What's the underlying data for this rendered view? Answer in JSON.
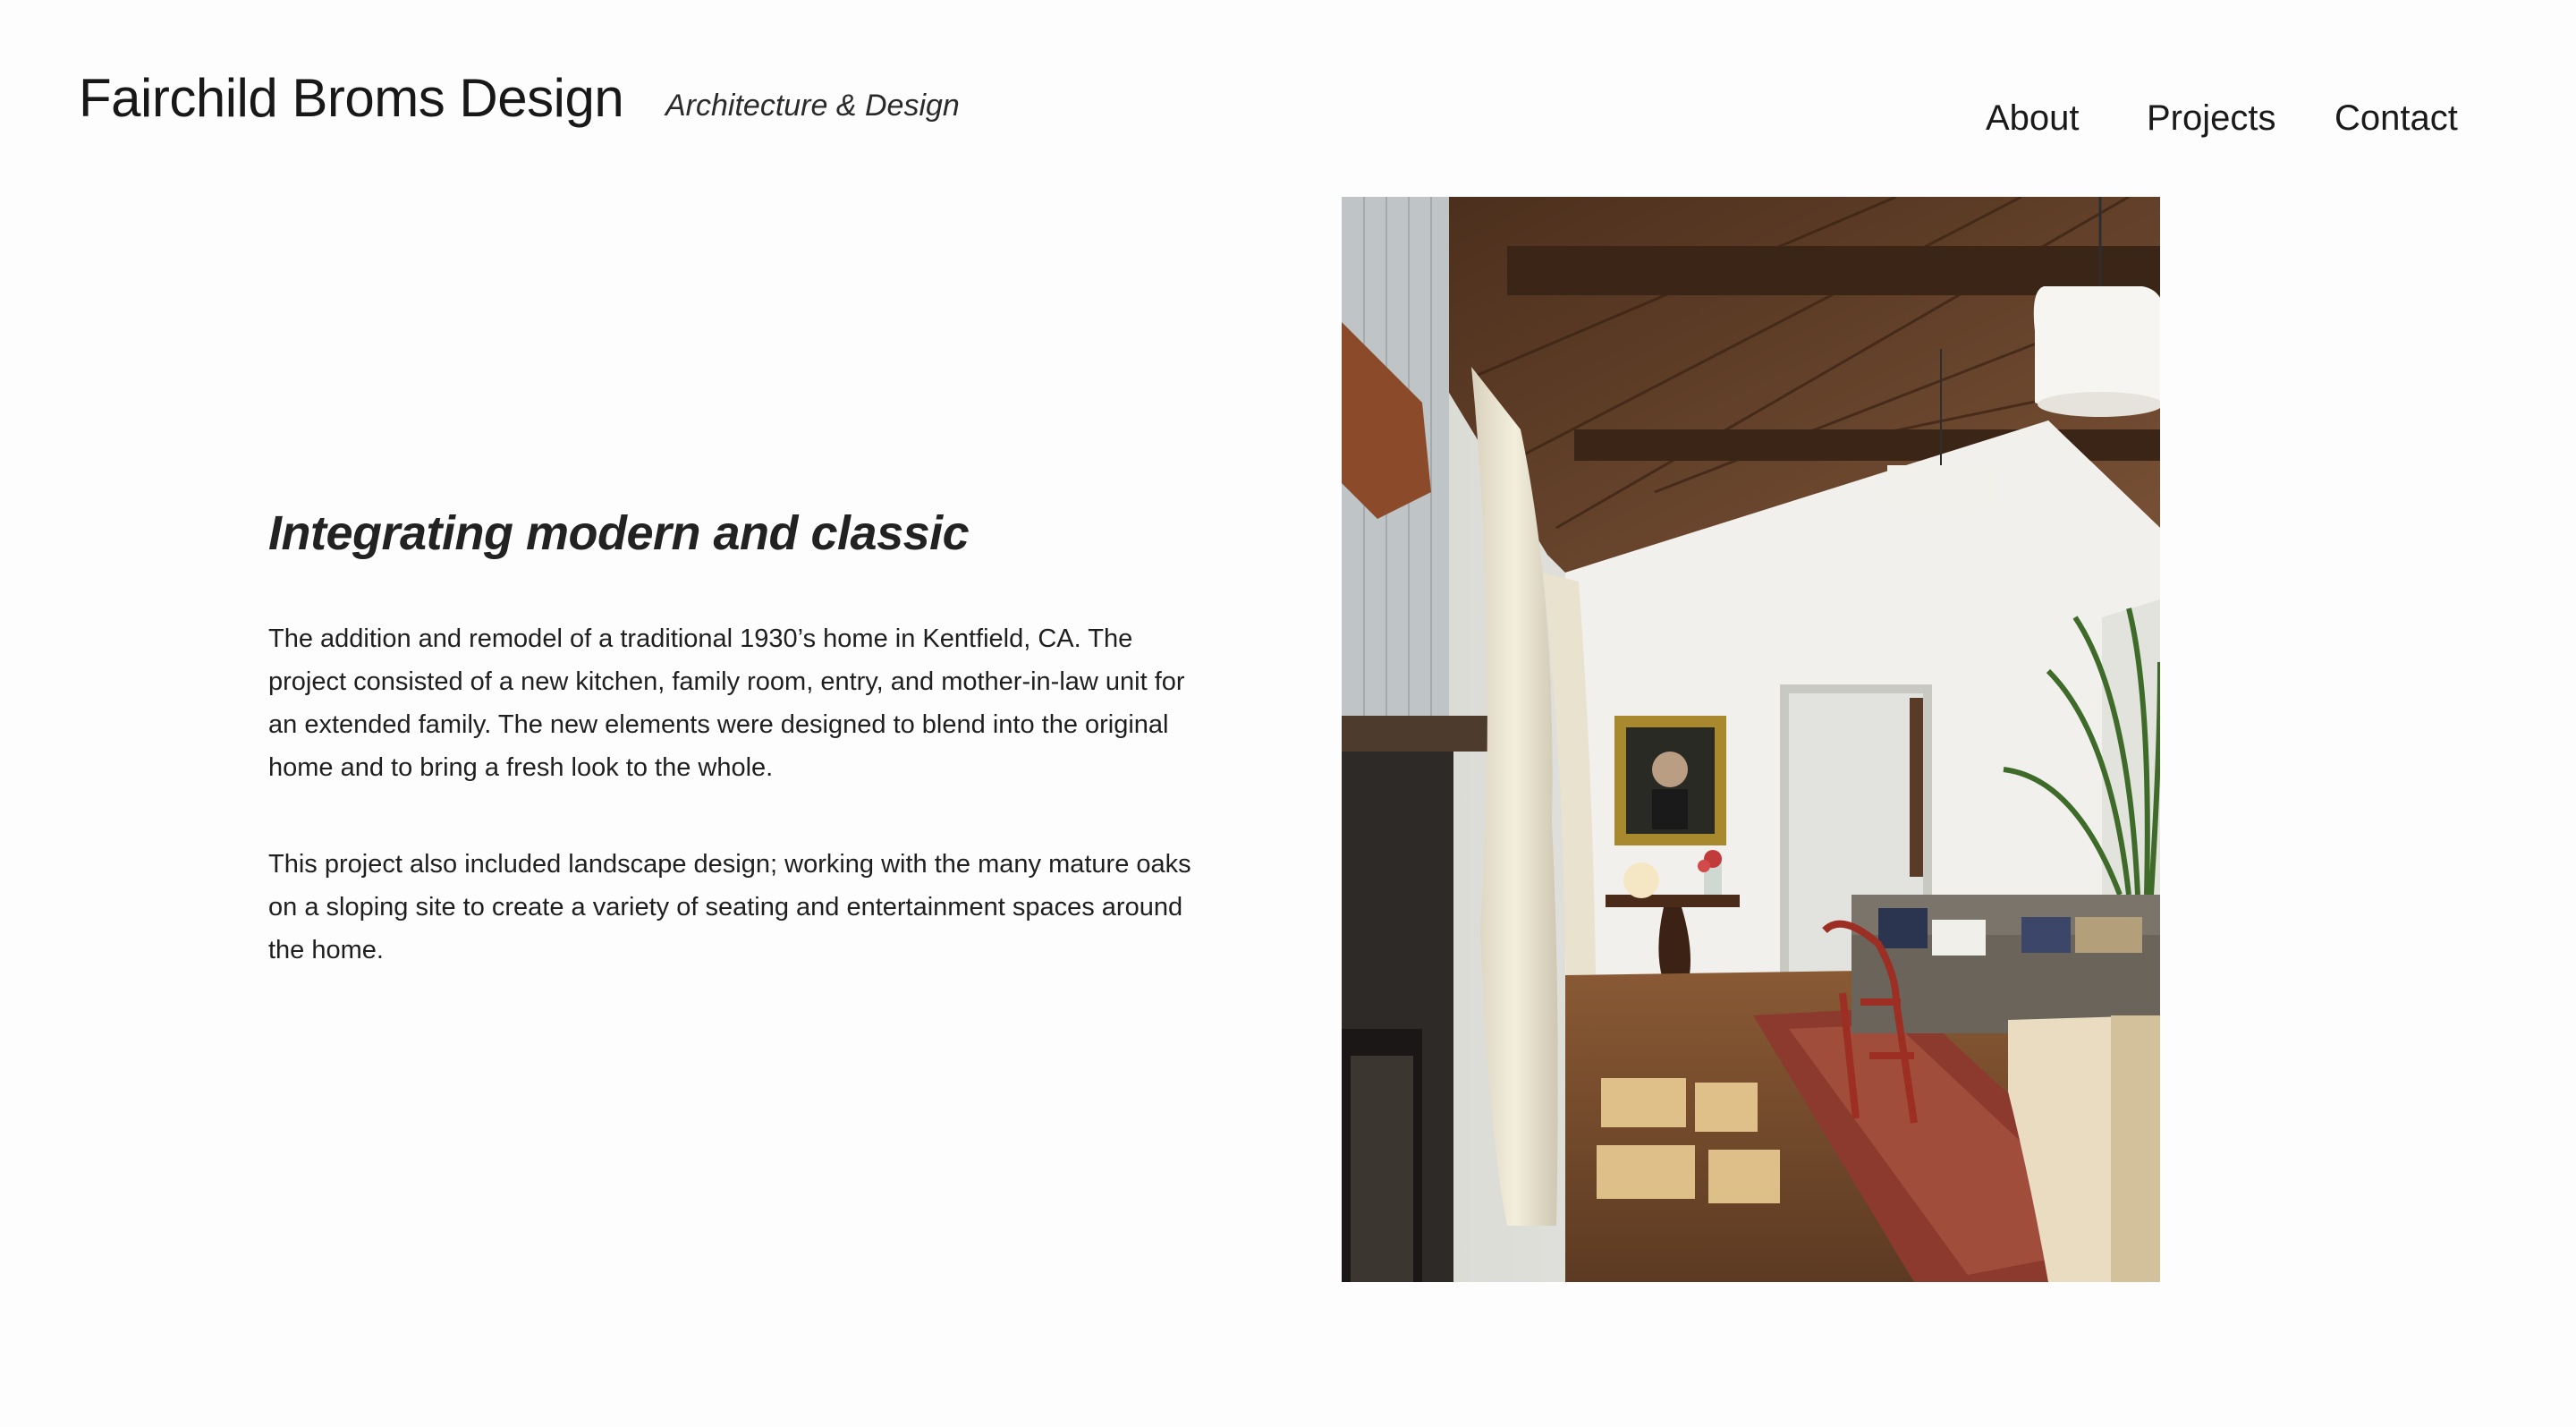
{
  "header": {
    "title": "Fairchild Broms Design",
    "tagline": "Architecture & Design"
  },
  "nav": {
    "items": [
      {
        "label": "About"
      },
      {
        "label": "Projects"
      },
      {
        "label": "Contact"
      }
    ]
  },
  "project": {
    "heading": "Integrating modern and classic",
    "paragraphs": [
      "The addition and remodel of a traditional 1930’s home in Kentfield, CA. The project consisted of a new kitchen, family room, entry, and mother-in-law unit for an extended family. The new elements were designed to blend into the original home and to bring a fresh look to the whole.",
      "This project also included landscape design; working with the many mature oaks on a sloping site to create a variety of seating and entertainment spaces around the home."
    ]
  },
  "colors": {
    "background": "#fdfdfd",
    "text": "#1c1c1c"
  }
}
